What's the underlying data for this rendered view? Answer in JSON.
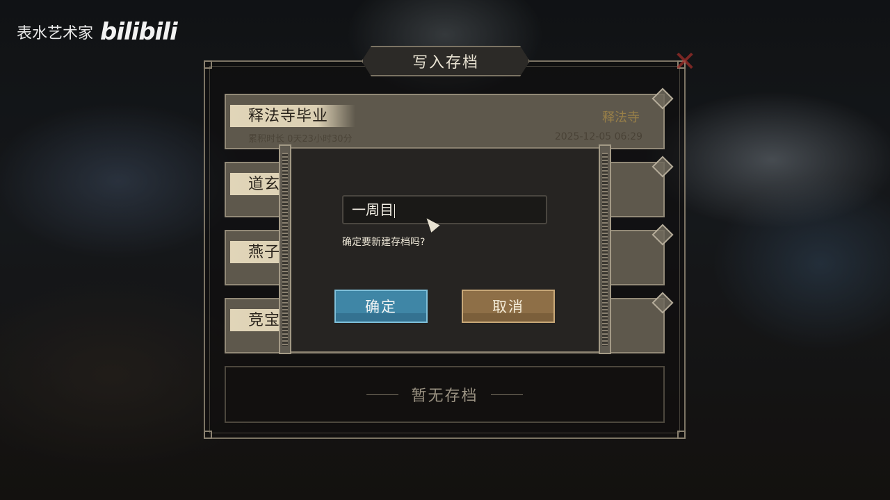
{
  "watermark": {
    "text": "表水艺术家",
    "logo": "bilibili"
  },
  "panel": {
    "title": "写入存档",
    "close_icon": "close-x-icon"
  },
  "slots": [
    {
      "name": "释法寺毕业",
      "meta": "累积时长 0天23小时30分",
      "date": "2025-12-05 06:29",
      "tag": "释法寺"
    },
    {
      "name": "道玄宗毕业",
      "meta": "",
      "date": "",
      "tag": ""
    },
    {
      "name": "燕子窝毕业",
      "meta": "",
      "date": "",
      "tag": ""
    },
    {
      "name": "竞宝大会毕业",
      "meta": "",
      "date": "",
      "tag": ""
    }
  ],
  "empty_slot_label": "暂无存档",
  "dialog": {
    "input_value": "一周目",
    "prompt": "确定要新建存档吗?",
    "confirm_label": "确定",
    "cancel_label": "取消"
  },
  "colors": {
    "confirm": "#3f86a6",
    "cancel": "#8e6f47",
    "close": "#a8302b"
  }
}
